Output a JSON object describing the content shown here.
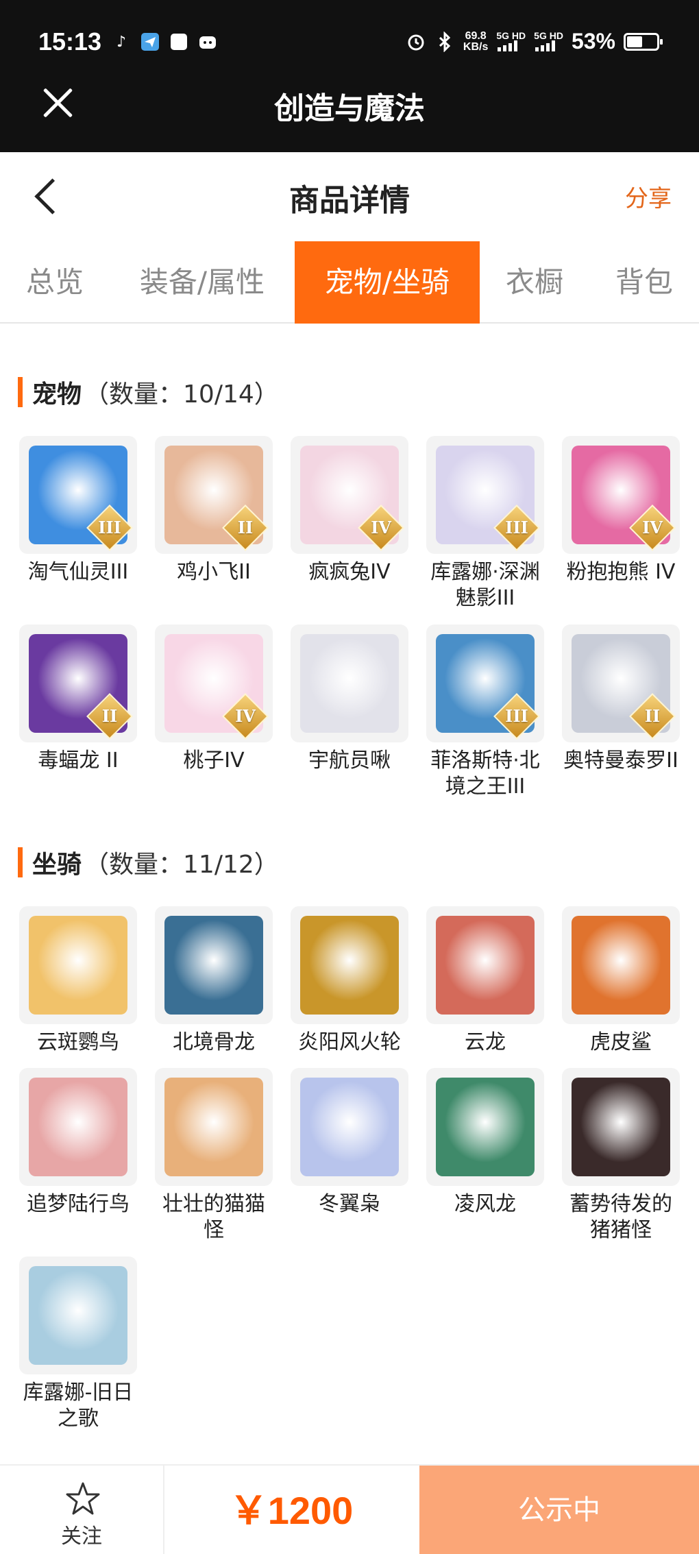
{
  "status_bar": {
    "time": "15:13",
    "speed_value": "69.8",
    "speed_unit": "KB/s",
    "net1": "5G HD",
    "net2": "5G HD",
    "battery": "53%",
    "battery_level": 0.53
  },
  "app": {
    "title": "创造与魔法"
  },
  "header": {
    "title": "商品详情",
    "share_label": "分享"
  },
  "tabs": [
    {
      "label": "总览",
      "active": false
    },
    {
      "label": "装备/属性",
      "active": false
    },
    {
      "label": "宠物/坐骑",
      "active": true
    },
    {
      "label": "衣橱",
      "active": false
    },
    {
      "label": "背包",
      "active": false
    }
  ],
  "pets": {
    "title": "宠物",
    "count": "（数量：10/14）",
    "items": [
      {
        "name": "淘气仙灵III",
        "tier": "III",
        "color": "#3f8ee0"
      },
      {
        "name": "鸡小飞II",
        "tier": "II",
        "color": "#e7b89a"
      },
      {
        "name": "疯疯兔IV",
        "tier": "IV",
        "color": "#f3d6e2"
      },
      {
        "name": "库露娜·深渊魅影III",
        "tier": "III",
        "color": "#d9d4ee"
      },
      {
        "name": "粉抱抱熊 IV",
        "tier": "IV",
        "color": "#e56aa3"
      },
      {
        "name": "毒蝠龙 II",
        "tier": "II",
        "color": "#6a3aa0"
      },
      {
        "name": "桃子IV",
        "tier": "IV",
        "color": "#f8d7e6"
      },
      {
        "name": "宇航员啾",
        "tier": "",
        "color": "#e2e2ea"
      },
      {
        "name": "菲洛斯特·北境之王III",
        "tier": "III",
        "color": "#4a8fc8"
      },
      {
        "name": "奥特曼泰罗II",
        "tier": "II",
        "color": "#c9cdd8"
      }
    ]
  },
  "mounts": {
    "title": "坐骑",
    "count": "（数量：11/12）",
    "items": [
      {
        "name": "云斑鹦鸟",
        "color": "#f1c26a"
      },
      {
        "name": "北境骨龙",
        "color": "#3a6f94"
      },
      {
        "name": "炎阳风火轮",
        "color": "#c9962a"
      },
      {
        "name": "云龙",
        "color": "#d46a5a"
      },
      {
        "name": "虎皮鲨",
        "color": "#e0732e"
      },
      {
        "name": "追梦陆行鸟",
        "color": "#e7a6a6"
      },
      {
        "name": "壮壮的猫猫怪",
        "color": "#e8b07a"
      },
      {
        "name": "冬翼枭",
        "color": "#b8c4ec"
      },
      {
        "name": "凌风龙",
        "color": "#3f8a6a"
      },
      {
        "name": "蓄势待发的猪猪怪",
        "color": "#3a2a2a"
      },
      {
        "name": "库露娜-旧日之歌",
        "color": "#a9cde0"
      }
    ]
  },
  "bottom_bar": {
    "follow_label": "关注",
    "price": "￥1200",
    "status_label": "公示中"
  },
  "colors": {
    "accent": "#ff6a0f",
    "share": "#e3661a",
    "price": "#ff5a00",
    "status_button": "#fba677"
  }
}
